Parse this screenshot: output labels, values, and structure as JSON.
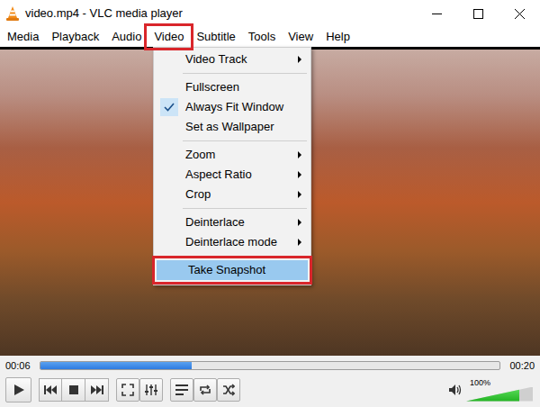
{
  "window": {
    "title": "video.mp4 - VLC media player"
  },
  "menubar": [
    {
      "label": "Media",
      "selected": false
    },
    {
      "label": "Playback",
      "selected": false
    },
    {
      "label": "Audio",
      "selected": false
    },
    {
      "label": "Video",
      "selected": true
    },
    {
      "label": "Subtitle",
      "selected": false
    },
    {
      "label": "Tools",
      "selected": false
    },
    {
      "label": "View",
      "selected": false
    },
    {
      "label": "Help",
      "selected": false
    }
  ],
  "video_menu": {
    "items": [
      {
        "kind": "item",
        "label": "Video Track",
        "submenu": true,
        "checked": false,
        "selected": false
      },
      {
        "kind": "separator"
      },
      {
        "kind": "item",
        "label": "Fullscreen",
        "submenu": false,
        "checked": false,
        "selected": false
      },
      {
        "kind": "item",
        "label": "Always Fit Window",
        "submenu": false,
        "checked": true,
        "selected": false
      },
      {
        "kind": "item",
        "label": "Set as Wallpaper",
        "submenu": false,
        "checked": false,
        "selected": false
      },
      {
        "kind": "separator"
      },
      {
        "kind": "item",
        "label": "Zoom",
        "submenu": true,
        "checked": false,
        "selected": false
      },
      {
        "kind": "item",
        "label": "Aspect Ratio",
        "submenu": true,
        "checked": false,
        "selected": false
      },
      {
        "kind": "item",
        "label": "Crop",
        "submenu": true,
        "checked": false,
        "selected": false
      },
      {
        "kind": "separator"
      },
      {
        "kind": "item",
        "label": "Deinterlace",
        "submenu": true,
        "checked": false,
        "selected": false
      },
      {
        "kind": "item",
        "label": "Deinterlace mode",
        "submenu": true,
        "checked": false,
        "selected": false
      },
      {
        "kind": "separator"
      },
      {
        "kind": "item",
        "label": "Take Snapshot",
        "submenu": false,
        "checked": false,
        "selected": true
      }
    ]
  },
  "seek": {
    "elapsed": "00:06",
    "total": "00:20",
    "level": 0.33
  },
  "volume": {
    "reading": "100%",
    "level": 0.8
  }
}
